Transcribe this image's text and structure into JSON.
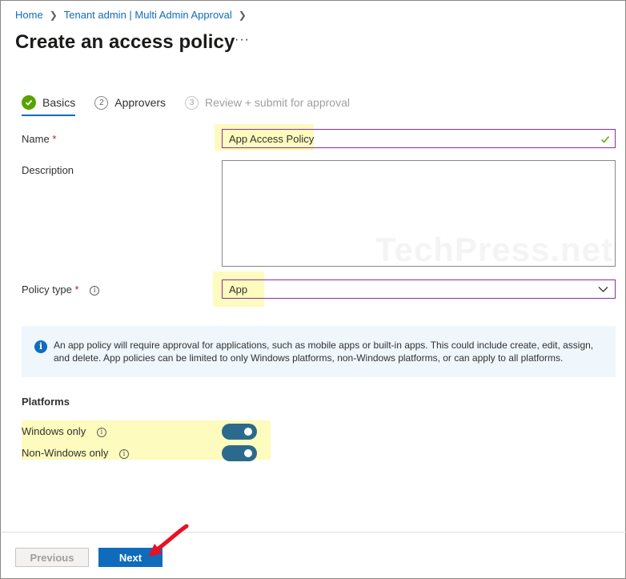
{
  "breadcrumb": {
    "home": "Home",
    "section": "Tenant admin | Multi Admin Approval"
  },
  "page": {
    "title": "Create an access policy",
    "more": "···"
  },
  "steps": [
    {
      "label": "Basics",
      "number": "",
      "state": "completed"
    },
    {
      "label": "Approvers",
      "number": "2",
      "state": "pending"
    },
    {
      "label": "Review + submit for approval",
      "number": "3",
      "state": "disabled"
    }
  ],
  "form": {
    "name_label": "Name",
    "name_required": "*",
    "name_value": "App Access Policy",
    "description_label": "Description",
    "description_value": "",
    "policy_type_label": "Policy type",
    "policy_type_required": "*",
    "policy_type_value": "App"
  },
  "watermark": "TechPress.net",
  "info_message": "An app policy will require approval for applications, such as mobile apps or built-in apps. This could include create, edit, assign, and delete. App policies can be limited to only Windows platforms, non-Windows platforms, or can apply to all platforms.",
  "platforms": {
    "title": "Platforms",
    "windows_label": "Windows only",
    "windows_on": true,
    "non_windows_label": "Non-Windows only",
    "non_windows_on": true
  },
  "footer": {
    "previous_label": "Previous",
    "next_label": "Next"
  },
  "colors": {
    "accent": "#0f6cbd",
    "success": "#57a300",
    "highlight": "#fdfbbd",
    "annotation_arrow": "#e81123"
  }
}
